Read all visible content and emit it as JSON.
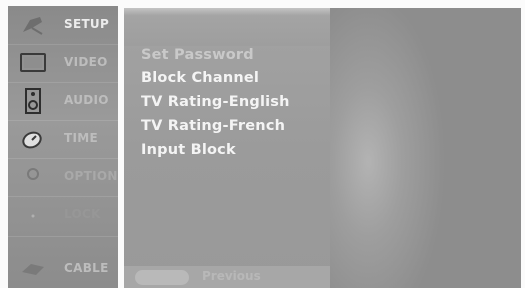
{
  "sidebar": {
    "items": [
      {
        "label": "SETUP",
        "icon": "satellite-dish-icon"
      },
      {
        "label": "VIDEO",
        "icon": "tv-screen-icon"
      },
      {
        "label": "AUDIO",
        "icon": "speaker-icon"
      },
      {
        "label": "TIME",
        "icon": "clock-icon"
      },
      {
        "label": "OPTION",
        "icon": "option-icon"
      },
      {
        "label": "LOCK",
        "icon": "lock-icon"
      },
      {
        "label": "CABLE",
        "icon": "cable-icon"
      }
    ]
  },
  "panel": {
    "options": [
      {
        "label": "Set Password"
      },
      {
        "label": "Block Channel"
      },
      {
        "label": "TV Rating-English"
      },
      {
        "label": "TV Rating-French"
      },
      {
        "label": "Input Block"
      }
    ],
    "footer": {
      "previous_label": "Previous"
    }
  },
  "colors": {
    "menu_bg": "#8f8f8f",
    "panel_bg": "#9e9e9e",
    "text_highlight": "#f4f4f4"
  }
}
